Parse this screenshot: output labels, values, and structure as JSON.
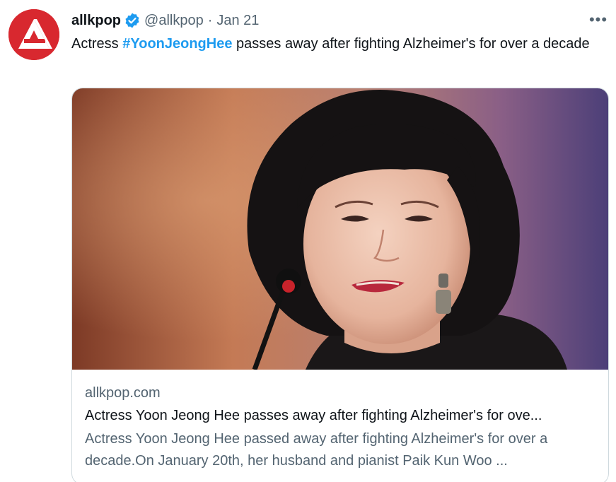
{
  "author": {
    "display_name": "allkpop",
    "handle": "@allkpop",
    "separator": "·",
    "date": "Jan 21",
    "avatar_icon": "allkpop-logo-icon",
    "verified_icon": "verified-badge-icon"
  },
  "more_icon": "more-options-icon",
  "more_label": "•••",
  "tweet": {
    "text_before": "Actress ",
    "hashtag": "#YoonJeongHee",
    "text_after": " passes away after fighting Alzheimer's for over a decade"
  },
  "card": {
    "image_icon": "article-photo",
    "domain": "allkpop.com",
    "title": "Actress Yoon Jeong Hee passes away after fighting Alzheimer's for ove...",
    "description": "Actress Yoon Jeong Hee passed away after fighting Alzheimer's for over a decade.On January 20th, her husband and pianist Paik Kun Woo ..."
  },
  "colors": {
    "link": "#1d9bf0",
    "secondary_text": "#536471",
    "primary_text": "#0f1419",
    "brand_red": "#d8282f",
    "border": "#cfd9de"
  }
}
